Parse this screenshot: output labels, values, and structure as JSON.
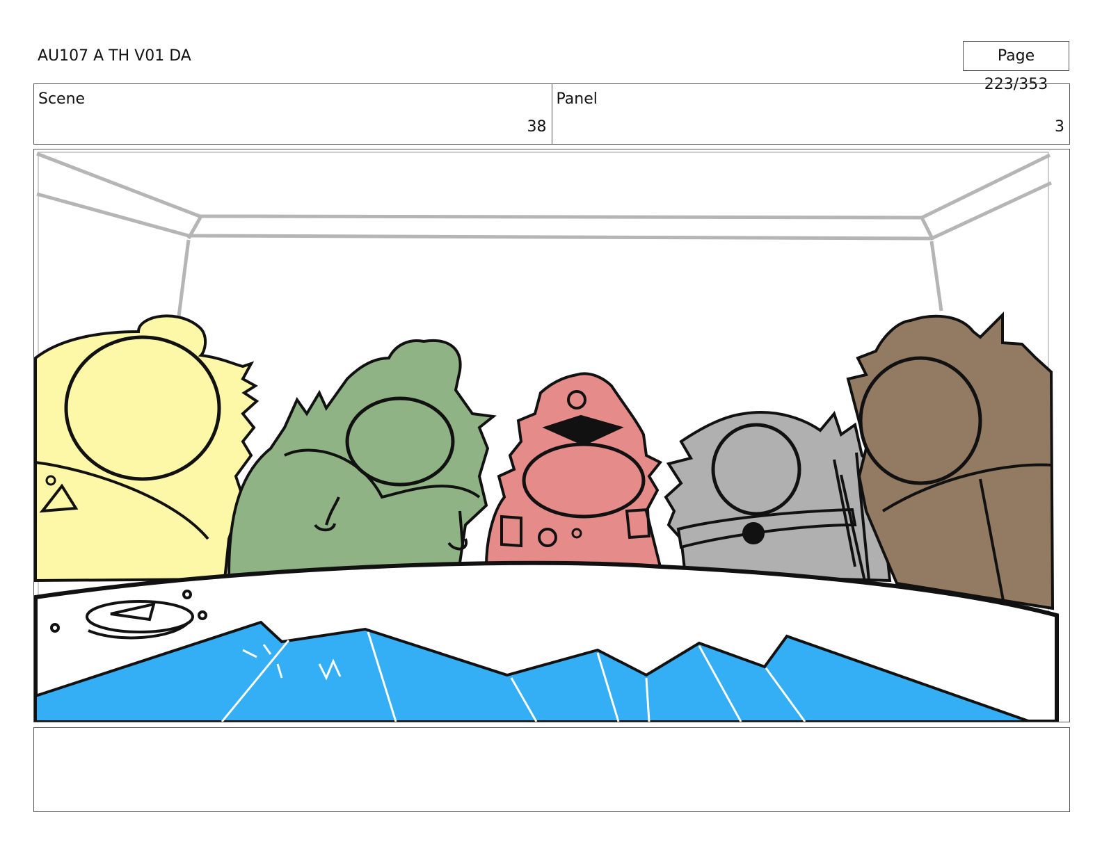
{
  "header": {
    "title": "AU107 A TH V01 DA",
    "page_label": "Page 223/353"
  },
  "info": {
    "scene_label": "Scene",
    "scene_value": "38",
    "panel_label": "Panel",
    "panel_value": "3"
  },
  "panel_image": {
    "description_icon": "storyboard-drawing",
    "colors": {
      "yellow": "#fdf8a8",
      "green": "#8fb384",
      "pink": "#e58c8a",
      "gray": "#b0b0b0",
      "brown": "#937a62",
      "water": "#34aef5",
      "ceiling": "#b5b5b5"
    }
  },
  "notes": {
    "text": ""
  }
}
